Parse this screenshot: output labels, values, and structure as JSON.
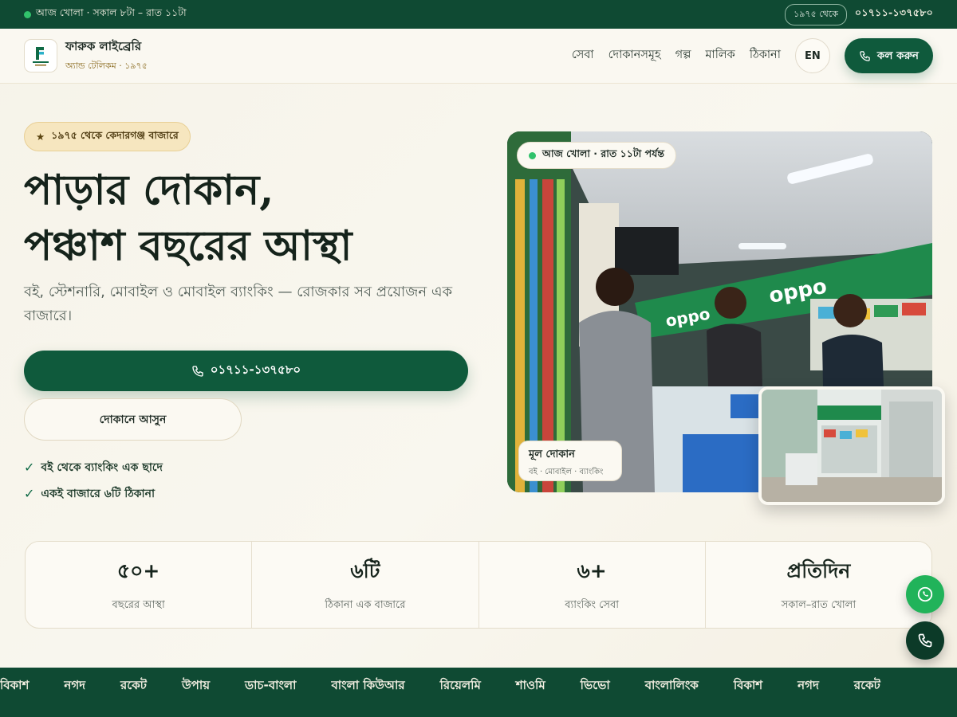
{
  "topbar": {
    "open_status": "আজ খোলা · সকাল ৮টা – রাত ১১টা",
    "since_badge": "১৯৭৫ থেকে",
    "phone": "০১৭১১-১৩৭৫৮০"
  },
  "header": {
    "brand_name": "ফারুক লাইব্রেরি",
    "brand_sub": "অ্যান্ড টেলিকম · ১৯৭৫",
    "nav": [
      "সেবা",
      "দোকানসমূহ",
      "গল্প",
      "মালিক",
      "ঠিকানা"
    ],
    "lang_label": "EN",
    "call_label": "কল করুন"
  },
  "hero": {
    "badge": "১৯৭৫ থেকে কেদারগঞ্জ বাজারে",
    "title_line1": "পাড়ার দোকান,",
    "title_line2": "পঞ্চাশ বছরের আস্থা",
    "description": "বই, স্টেশনারি, মোবাইল ও মোবাইল ব্যাংকিং — রোজকার সব প্রয়োজন এক বাজারে।",
    "call_button": "০১৭১১-১৩৭৫৮০",
    "visit_button": "দোকানে আসুন",
    "checks": [
      "বই থেকে ব্যাংকিং এক ছাদে",
      "একই বাজারে ৬টি ঠিকানা"
    ]
  },
  "photo": {
    "open_pill": "আজ খোলা · রাত ১১টা পর্যন্ত",
    "caption_title": "মূল দোকান",
    "caption_sub": "বই · মোবাইল · ব্যাংকিং",
    "sign_text": "oppo"
  },
  "stats": [
    {
      "value": "৫০+",
      "label": "বছরের আস্থা"
    },
    {
      "value": "৬টি",
      "label": "ঠিকানা এক বাজারে"
    },
    {
      "value": "৬+",
      "label": "ব্যাংকিং সেবা"
    },
    {
      "value": "প্রতিদিন",
      "label": "সকাল–রাত খোলা"
    }
  ],
  "ticker": [
    "বিকাশ",
    "নগদ",
    "রকেট",
    "উপায়",
    "ডাচ-বাংলা",
    "বাংলা কিউআর",
    "রিয়েলমি",
    "শাওমি",
    "ভিভো",
    "বাংলালিংক",
    "বিকাশ",
    "নগদ",
    "রকেট"
  ],
  "colors": {
    "primary": "#0f5a3c",
    "dark": "#0f4a33",
    "accent": "#f6e6bf",
    "whatsapp": "#21b35a"
  }
}
